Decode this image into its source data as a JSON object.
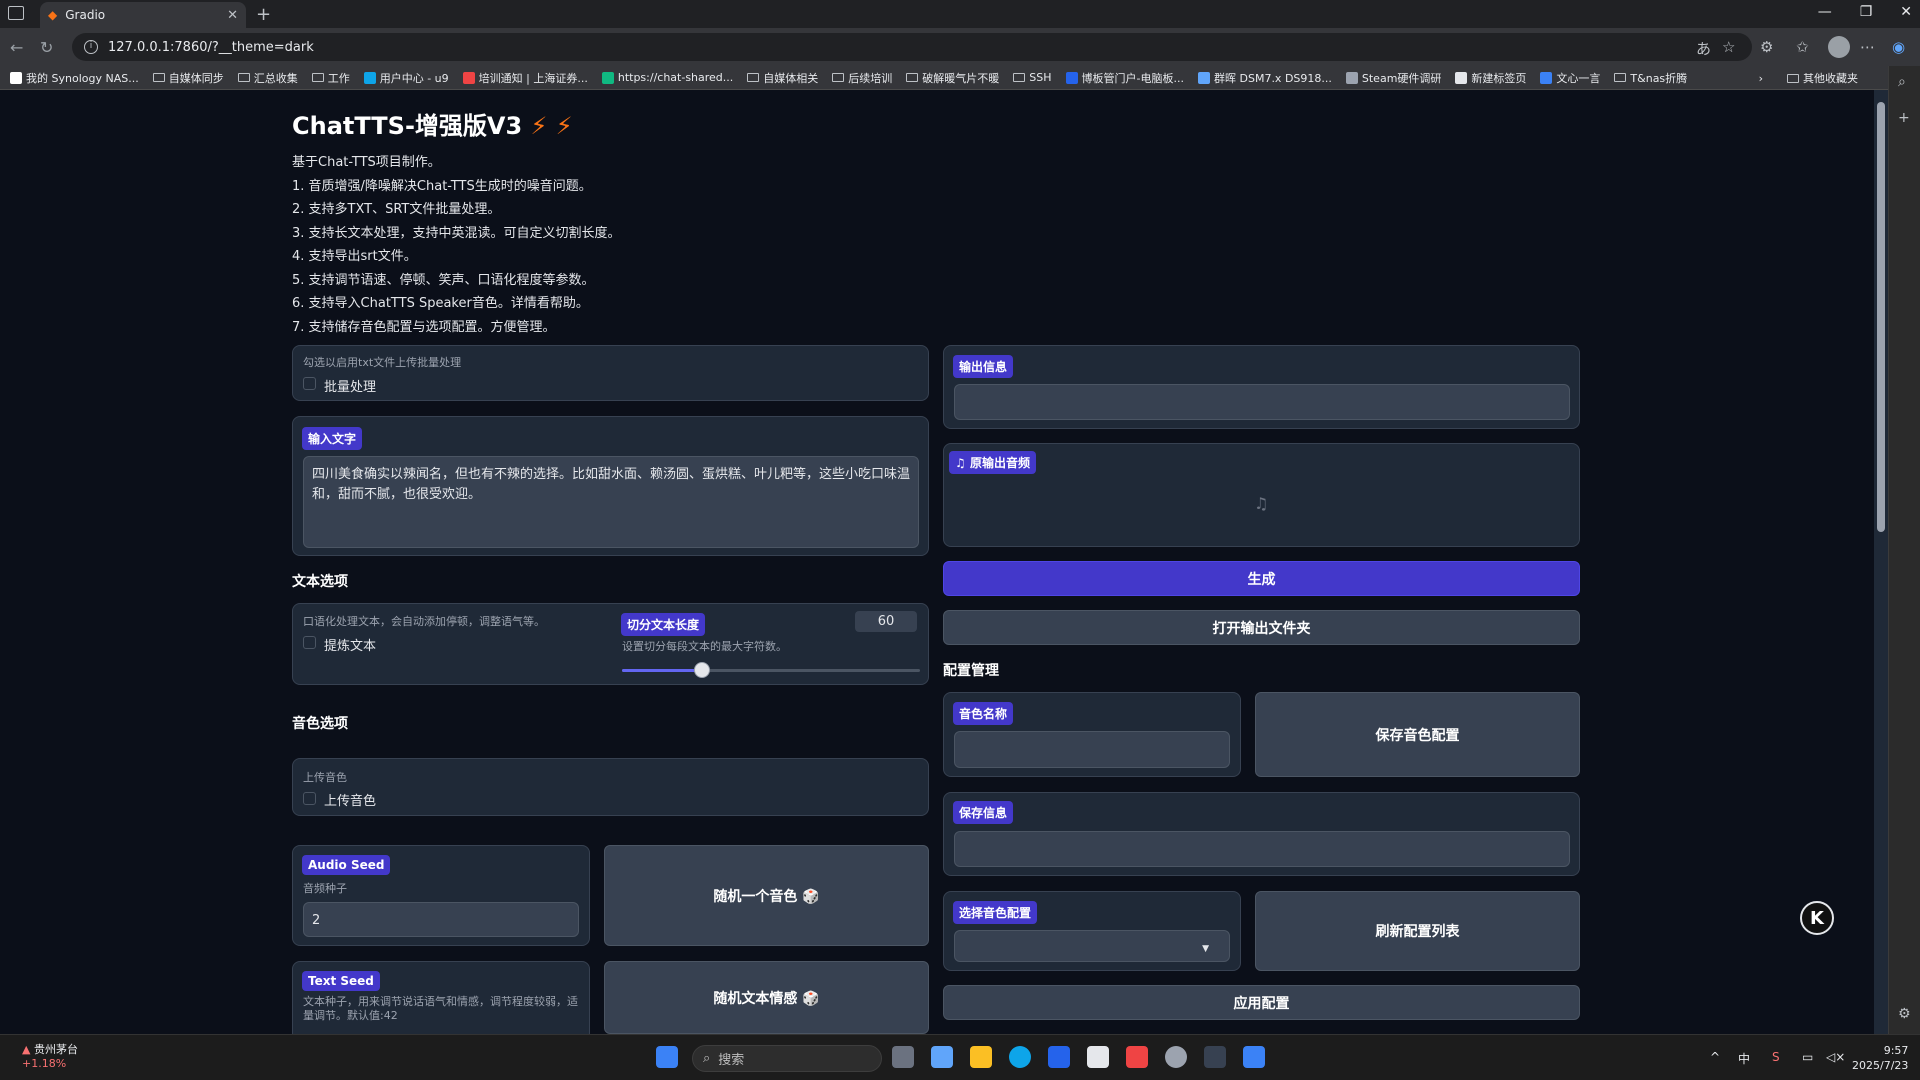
{
  "browser": {
    "tab_title": "Gradio",
    "url": "127.0.0.1:7860/?__theme=dark",
    "bookmarks": [
      "我的 Synology NAS...",
      "自媒体同步",
      "汇总收集",
      "工作",
      "用户中心 - u9",
      "培训通知 | 上海证券...",
      "https://chat-shared...",
      "自媒体相关",
      "后续培训",
      "破解暖气片不暖",
      "SSH",
      "博板管门户-电脑板...",
      "群晖 DSM7.x DS918...",
      "Steam硬件调研",
      "新建标签页",
      "文心一言",
      "T&nas折腾"
    ],
    "bookmarks_other": "其他收藏夹"
  },
  "app": {
    "title": "ChatTTS-增强版V3",
    "description": [
      "基于Chat-TTS项目制作。",
      "1. 音质增强/降噪解决Chat-TTS生成时的噪音问题。",
      "2. 支持多TXT、SRT文件批量处理。",
      "3. 支持长文本处理，支持中英混读。可自定义切割长度。",
      "4. 支持导出srt文件。",
      "5. 支持调节语速、停顿、笑声、口语化程度等参数。",
      "6. 支持导入ChatTTS Speaker音色。详情看帮助。",
      "7. 支持储存音色配置与选项配置。方便管理。"
    ],
    "batch": {
      "hint": "勾选以启用txt文件上传批量处理",
      "label": "批量处理"
    },
    "input": {
      "label": "输入文字",
      "value": "四川美食确实以辣闻名，但也有不辣的选择。比如甜水面、赖汤圆、蛋烘糕、叶儿粑等，这些小吃口味温和，甜而不腻，也很受欢迎。"
    },
    "text_options": {
      "title": "文本选项",
      "refine_hint": "口语化处理文本，会自动添加停顿，调整语气等。",
      "refine_label": "提炼文本",
      "split_label": "切分文本长度",
      "split_hint": "设置切分每段文本的最大字符数。",
      "split_value": "60",
      "split_fraction": 0.27
    },
    "voice_options": {
      "title": "音色选项",
      "upload_hint": "上传音色",
      "upload_label": "上传音色"
    },
    "audio_seed": {
      "label": "Audio Seed",
      "hint": "音频种子",
      "value": "2"
    },
    "random_voice": "随机一个音色 🎲",
    "text_seed": {
      "label": "Text Seed",
      "hint": "文本种子，用来调节说话语气和情感，调节程度较弱，适量调节。默认值:42"
    },
    "random_text": "随机文本情感 🎲",
    "output_info": {
      "label": "输出信息"
    },
    "output_audio": {
      "label": "原输出音频"
    },
    "generate": "生成",
    "open_folder": "打开输出文件夹",
    "config": {
      "title": "配置管理",
      "voice_name_label": "音色名称",
      "save_voice": "保存音色配置",
      "save_info_label": "保存信息",
      "select_label": "选择音色配置",
      "refresh": "刷新配置列表",
      "apply": "应用配置"
    }
  },
  "taskbar": {
    "stock_name": "贵州茅台",
    "stock_change": "+1.18%",
    "search": "搜索",
    "time": "9:57",
    "date": "2025/7/23"
  }
}
